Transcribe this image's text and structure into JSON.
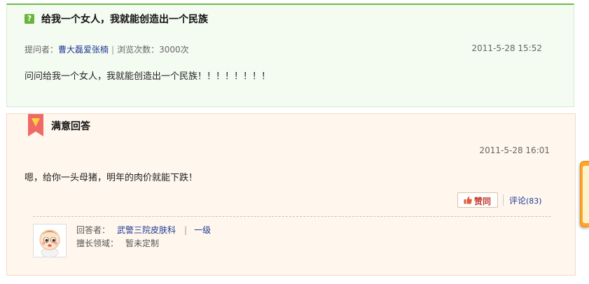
{
  "question": {
    "icon": "question-icon",
    "title": "给我一个女人，我就能创造出一个民族",
    "asker_label": "提问者：",
    "asker_name": "曹大磊爱张楠",
    "sep": "|",
    "views_label": "浏览次数：3000次",
    "date": "2011-5-28 15:52",
    "body": "问问给我一个女人，我就能创造出一个民族！！！！！！！！"
  },
  "answer": {
    "badge_icon": "ribbon-badge-icon",
    "title": "满意回答",
    "date": "2011-5-28 16:01",
    "body": "嗯，给你一头母猪，明年的肉价就能下跌！",
    "like_label": "赞同",
    "comment_label": "评论",
    "comment_count": "(83)",
    "answerer_label": "回答者：",
    "answerer_name": "武警三院皮肤科",
    "pipe": "|",
    "level": "一级",
    "field_label": "擅长领域：",
    "field_value": "暂未定制"
  },
  "colors": {
    "question_accent": "#6cbb47",
    "answer_bg": "#fff6ed",
    "like_text": "#c0392b",
    "side_tab": "#ffa52b"
  }
}
